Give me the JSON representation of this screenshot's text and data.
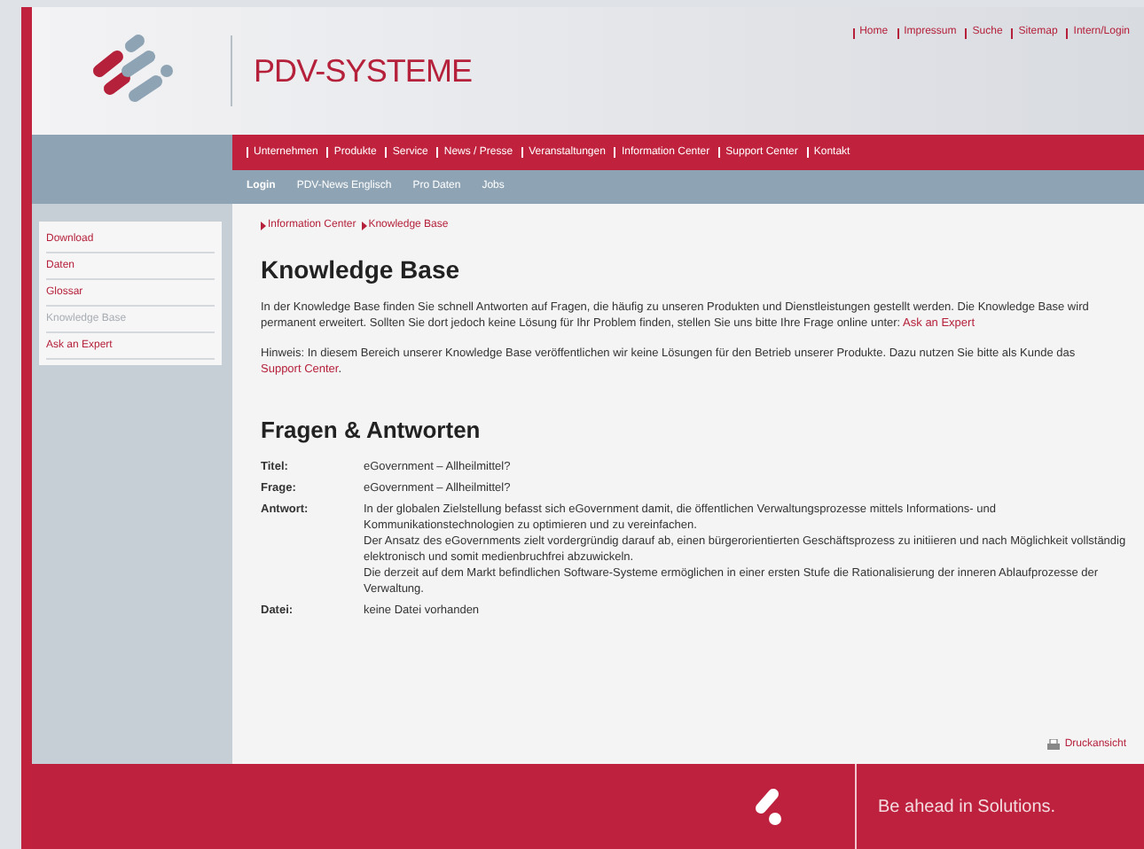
{
  "header": {
    "brand": "PDV-SYSTEME",
    "top_links": [
      "Home",
      "Impressum",
      "Suche",
      "Sitemap",
      "Intern/Login"
    ]
  },
  "main_nav": [
    "Unternehmen",
    "Produkte",
    "Service",
    "News / Presse",
    "Veranstaltungen",
    "Information Center",
    "Support Center",
    "Kontakt"
  ],
  "sub_nav": [
    "Login",
    "PDV-News Englisch",
    "Pro Daten",
    "Jobs"
  ],
  "sidebar": {
    "items": [
      {
        "label": "Download",
        "selected": false
      },
      {
        "label": "Daten",
        "selected": false
      },
      {
        "label": "Glossar",
        "selected": false
      },
      {
        "label": "Knowledge Base",
        "selected": true
      },
      {
        "label": "Ask an Expert",
        "selected": false
      }
    ]
  },
  "breadcrumb": [
    "Information Center",
    "Knowledge Base"
  ],
  "title": "Knowledge Base",
  "paragraphs": [
    {
      "text": "In der Knowledge Base finden Sie schnell Antworten auf Fragen, die häufig zu unseren Produkten und Dienstleistungen gestellt werden. Die Knowledge Base wird permanent erweitert. Sollten Sie dort jedoch keine Lösung für Ihr Problem finden, stellen Sie uns bitte Ihre Frage online unter: ",
      "link": "Ask an Expert"
    },
    {
      "text": "Hinweis: In diesem Bereich unserer Knowledge Base veröffentlichen wir keine Lösungen für den Betrieb unserer Produkte. Dazu nutzen Sie bitte als Kunde das ",
      "link": "Support Center",
      "after": "."
    }
  ],
  "qa_title": "Fragen & Antworten",
  "qa": [
    {
      "label": "Titel:",
      "lines": [
        "eGovernment – Allheilmittel?"
      ]
    },
    {
      "label": "Frage:",
      "lines": [
        "eGovernment – Allheilmittel?"
      ]
    },
    {
      "label": "Antwort:",
      "lines": [
        "In der globalen Zielstellung befasst sich eGovernment damit, die öffentlichen Verwaltungsprozesse mittels Informations- und Kommunikationstechnologien zu optimieren und zu vereinfachen.",
        "Der Ansatz des eGovernments zielt vordergründig darauf ab, einen bürgerorientierten Geschäftsprozess zu initiieren und nach Möglichkeit vollständig elektronisch und somit medienbruchfrei abzuwickeln.",
        "Die derzeit auf dem Markt befindlichen Software-Systeme ermöglichen in einer ersten Stufe die Rationalisierung der inneren Ablaufprozesse der Verwaltung."
      ]
    },
    {
      "label": "Datei:",
      "lines": [
        "keine Datei vorhanden"
      ]
    }
  ],
  "print_link": "Druckansicht",
  "footer": {
    "slogan": "Be ahead in Solutions."
  }
}
